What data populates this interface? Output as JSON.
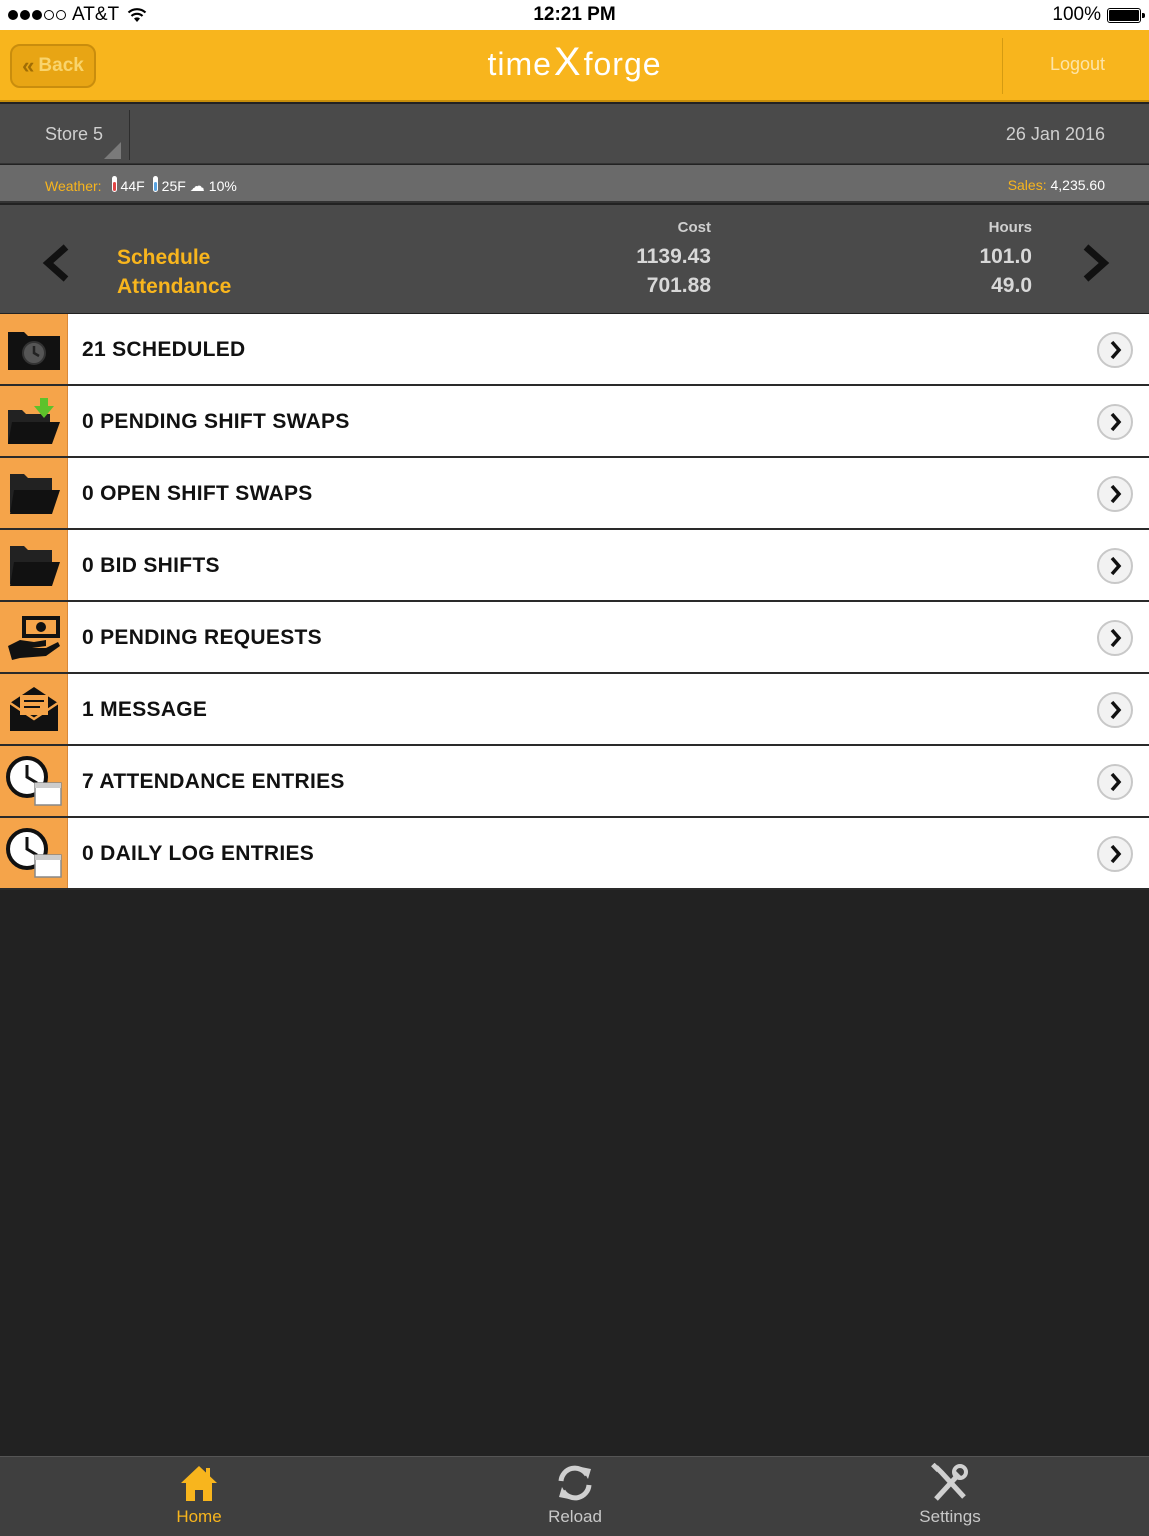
{
  "status_bar": {
    "carrier": "AT&T",
    "time": "12:21 PM",
    "battery": "100%"
  },
  "header": {
    "back_label": "Back",
    "logo_left": "time",
    "logo_mark": "X",
    "logo_right": "forge",
    "logout_label": "Logout"
  },
  "store": {
    "name": "Store 5",
    "date": "26 Jan 2016"
  },
  "weather": {
    "label": "Weather:",
    "high": "44F",
    "low": "25F",
    "precip": "10%",
    "sales_label": "Sales:",
    "sales_value": "4,235.60"
  },
  "summary": {
    "row1_label": "Schedule",
    "row2_label": "Attendance",
    "cost_header": "Cost",
    "hours_header": "Hours",
    "schedule_cost": "1139.43",
    "attendance_cost": "701.88",
    "schedule_hours": "101.0",
    "attendance_hours": "49.0"
  },
  "list": {
    "items": [
      {
        "label": "21 SCHEDULED",
        "icon": "clock-folder-icon"
      },
      {
        "label": "0 PENDING SHIFT SWAPS",
        "icon": "folder-download-icon"
      },
      {
        "label": "0 OPEN SHIFT SWAPS",
        "icon": "open-folder-icon"
      },
      {
        "label": "0 BID SHIFTS",
        "icon": "open-folder-icon"
      },
      {
        "label": "0 PENDING REQUESTS",
        "icon": "hand-money-icon"
      },
      {
        "label": "1 MESSAGE",
        "icon": "envelope-icon"
      },
      {
        "label": "7 ATTENDANCE ENTRIES",
        "icon": "clock-calendar-icon"
      },
      {
        "label": "0 DAILY LOG ENTRIES",
        "icon": "clock-calendar-icon"
      }
    ]
  },
  "tabbar": {
    "home_label": "Home",
    "reload_label": "Reload",
    "settings_label": "Settings"
  },
  "colors": {
    "brand_orange": "#f8b51d",
    "icon_bg": "#f5a44a",
    "panel_gray": "#4a4a4a",
    "background": "#222222"
  }
}
